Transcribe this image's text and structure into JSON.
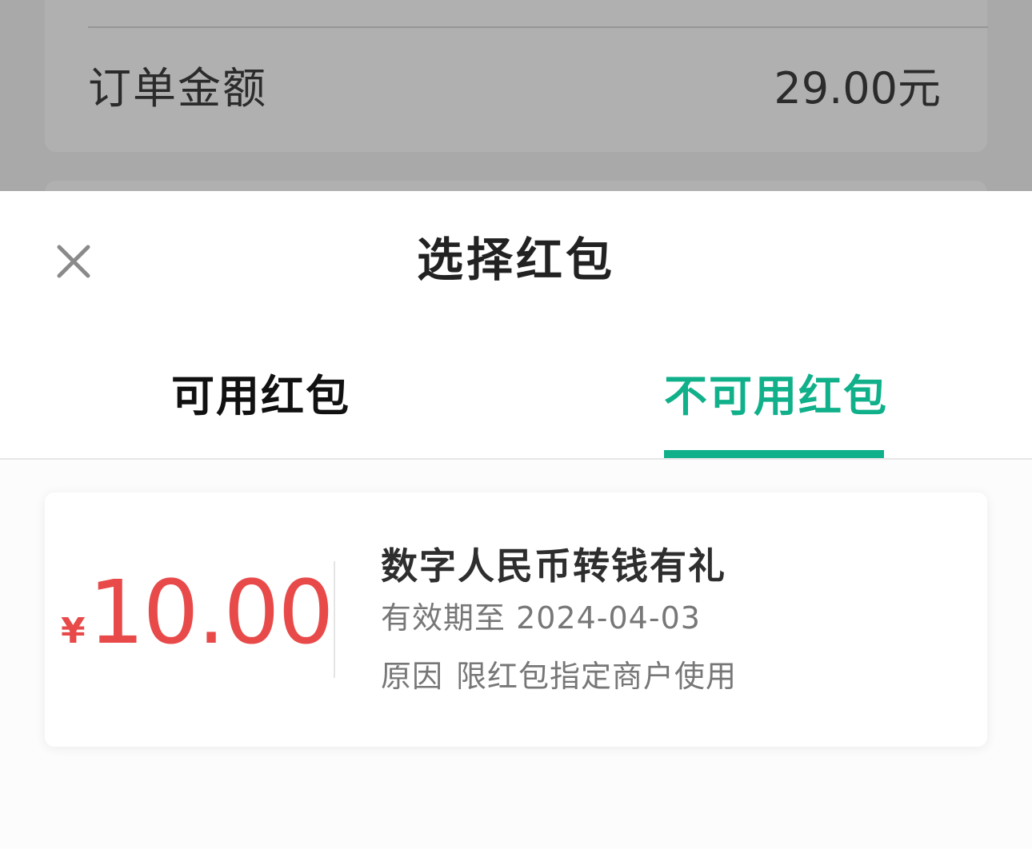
{
  "background": {
    "order_amount_label": "订单金额",
    "order_amount_value": "29.00元"
  },
  "sheet": {
    "title": "选择红包",
    "close_icon": "close-icon"
  },
  "tabs": [
    {
      "label": "可用红包",
      "active": false
    },
    {
      "label": "不可用红包",
      "active": true
    }
  ],
  "colors": {
    "accent": "#10b08a",
    "amount_red": "#e84a4a"
  },
  "coupons": [
    {
      "currency": "¥",
      "amount": "10.00",
      "name": "数字人民币转钱有礼",
      "expiry": "有效期至 2024-04-03",
      "reason_label": "原因",
      "reason": "限红包指定商户使用"
    }
  ]
}
